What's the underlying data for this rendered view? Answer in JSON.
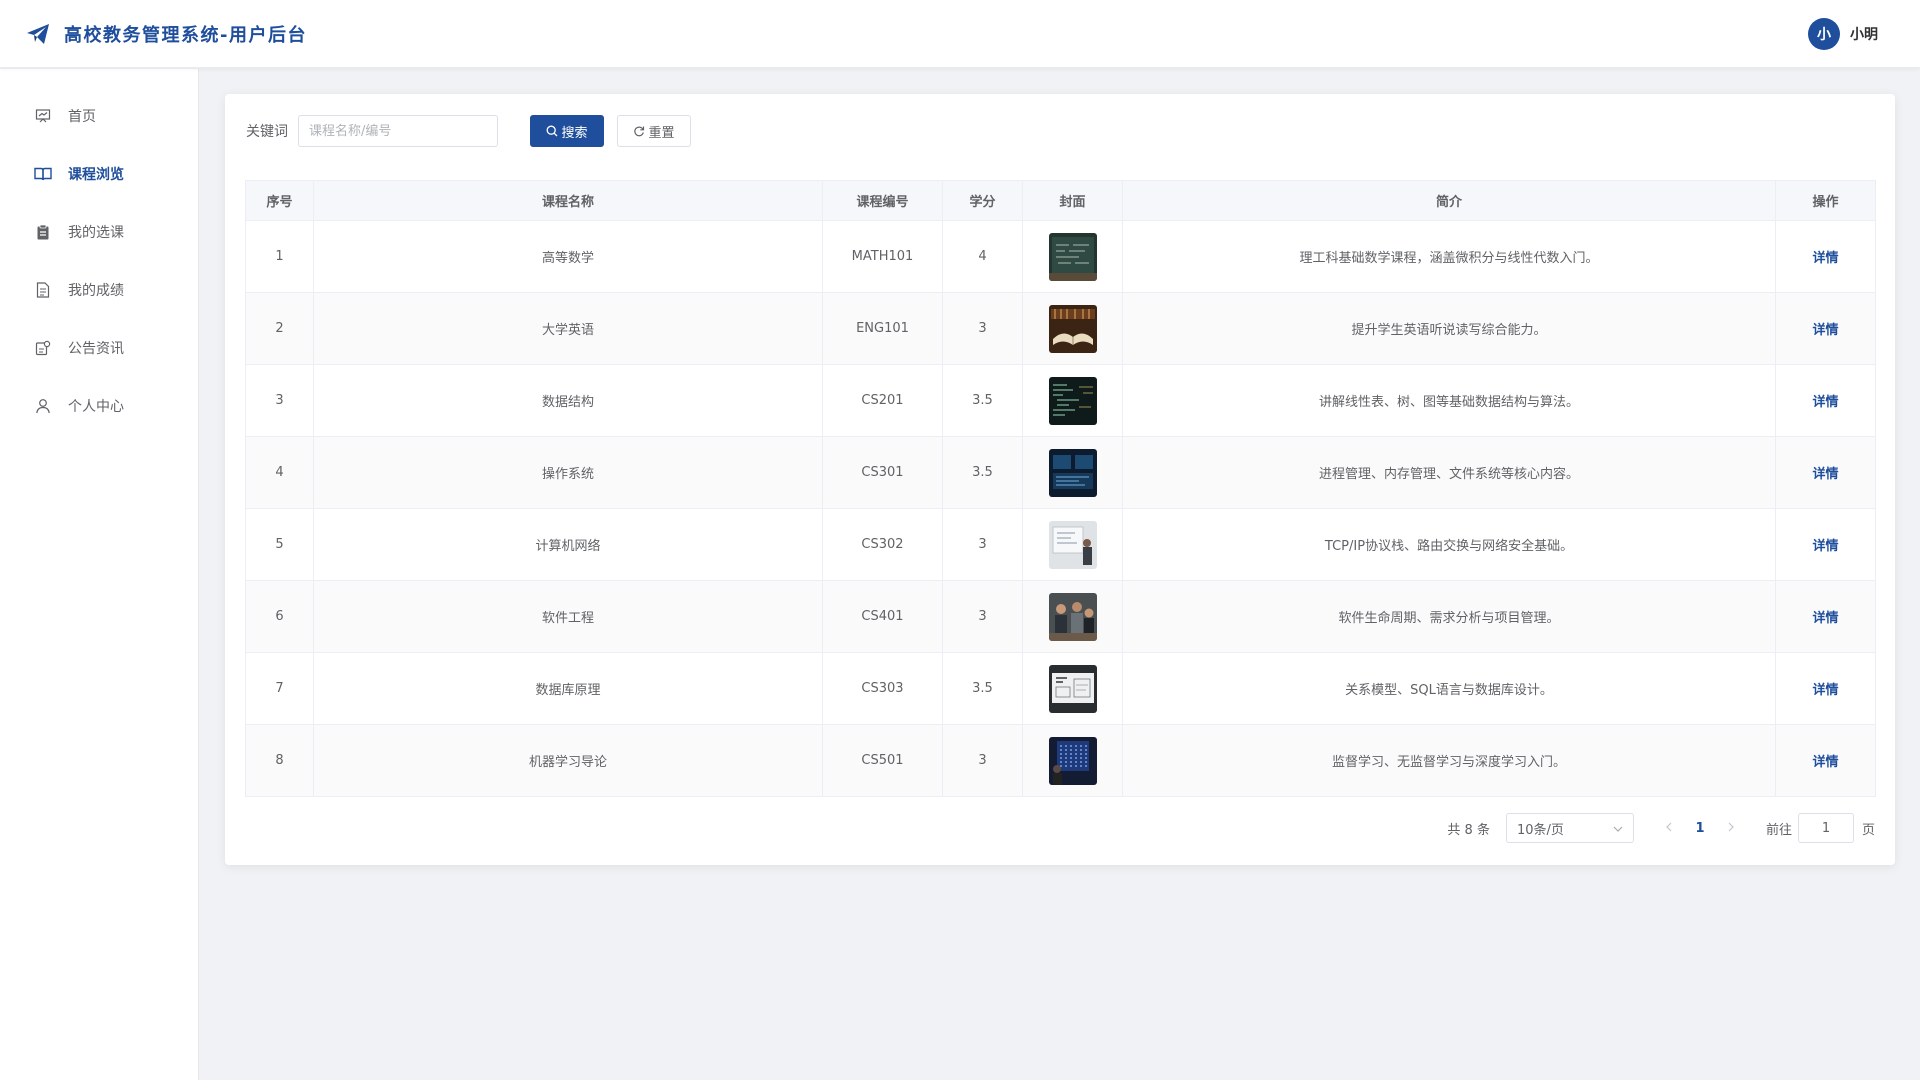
{
  "header": {
    "app_title": "高校教务管理系统-用户后台",
    "logo_icon": "paper-plane-icon",
    "user_avatar": "小",
    "username": "小明"
  },
  "sidebar": {
    "items": [
      {
        "label": "首页",
        "icon": "presentation-icon"
      },
      {
        "label": "课程浏览",
        "icon": "book-open-icon",
        "active": true
      },
      {
        "label": "我的选课",
        "icon": "clipboard-icon"
      },
      {
        "label": "我的成绩",
        "icon": "document-icon"
      },
      {
        "label": "公告资讯",
        "icon": "notice-icon"
      },
      {
        "label": "个人中心",
        "icon": "user-icon"
      }
    ]
  },
  "search": {
    "label": "关键词",
    "placeholder": "课程名称/编号",
    "value": "",
    "search_button": "搜索",
    "reset_button": "重置"
  },
  "table": {
    "headers": [
      "序号",
      "课程名称",
      "课程编号",
      "学分",
      "封面",
      "简介",
      "操作"
    ],
    "rows": [
      {
        "index": "1",
        "name": "高等数学",
        "code": "MATH101",
        "credit": "4",
        "intro": "理工科基础数学课程，涵盖微积分与线性代数入门。",
        "action": "详情"
      },
      {
        "index": "2",
        "name": "大学英语",
        "code": "ENG101",
        "credit": "3",
        "intro": "提升学生英语听说读写综合能力。",
        "action": "详情"
      },
      {
        "index": "3",
        "name": "数据结构",
        "code": "CS201",
        "credit": "3.5",
        "intro": "讲解线性表、树、图等基础数据结构与算法。",
        "action": "详情"
      },
      {
        "index": "4",
        "name": "操作系统",
        "code": "CS301",
        "credit": "3.5",
        "intro": "进程管理、内存管理、文件系统等核心内容。",
        "action": "详情"
      },
      {
        "index": "5",
        "name": "计算机网络",
        "code": "CS302",
        "credit": "3",
        "intro": "TCP/IP协议栈、路由交换与网络安全基础。",
        "action": "详情"
      },
      {
        "index": "6",
        "name": "软件工程",
        "code": "CS401",
        "credit": "3",
        "intro": "软件生命周期、需求分析与项目管理。",
        "action": "详情"
      },
      {
        "index": "7",
        "name": "数据库原理",
        "code": "CS303",
        "credit": "3.5",
        "intro": "关系模型、SQL语言与数据库设计。",
        "action": "详情"
      },
      {
        "index": "8",
        "name": "机器学习导论",
        "code": "CS501",
        "credit": "3",
        "intro": "监督学习、无监督学习与深度学习入门。",
        "action": "详情"
      }
    ]
  },
  "pagination": {
    "total_text": "共 8 条",
    "page_size": "10条/页",
    "current_page": "1",
    "goto_label": "前往",
    "goto_value": "1",
    "page_unit": "页"
  },
  "colors": {
    "primary": "#1f4e9c",
    "background": "#f0f2f5",
    "text": "#606266"
  }
}
